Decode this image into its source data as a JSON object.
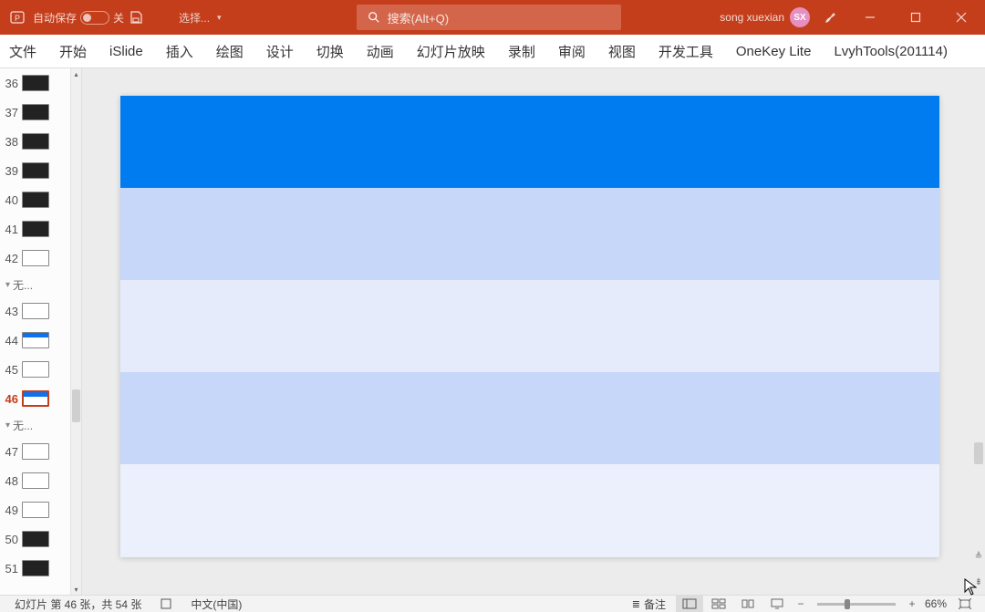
{
  "title_bar": {
    "autosave_label": "自动保存",
    "autosave_state": "关",
    "select_label": "选择...",
    "search_placeholder": "搜索(Alt+Q)",
    "user_name": "song xuexian",
    "user_initials": "SX"
  },
  "ribbon": {
    "tabs": [
      "文件",
      "开始",
      "iSlide",
      "插入",
      "绘图",
      "设计",
      "切换",
      "动画",
      "幻灯片放映",
      "录制",
      "审阅",
      "视图",
      "开发工具",
      "OneKey Lite",
      "LvyhTools(201114)"
    ],
    "active_index": -1
  },
  "slides_pane": {
    "items": [
      {
        "num": "36",
        "kind": "dark"
      },
      {
        "num": "37",
        "kind": "dark"
      },
      {
        "num": "38",
        "kind": "dark"
      },
      {
        "num": "39",
        "kind": "dark"
      },
      {
        "num": "40",
        "kind": "dark"
      },
      {
        "num": "41",
        "kind": "dark"
      },
      {
        "num": "42",
        "kind": "white"
      }
    ],
    "section1": "无...",
    "items2": [
      {
        "num": "43",
        "kind": "white"
      },
      {
        "num": "44",
        "kind": "whiteblue"
      },
      {
        "num": "45",
        "kind": "white"
      },
      {
        "num": "46",
        "kind": "whiteblue",
        "current": true
      }
    ],
    "section2": "无...",
    "items3": [
      {
        "num": "47",
        "kind": "white"
      },
      {
        "num": "48",
        "kind": "white"
      },
      {
        "num": "49",
        "kind": "white"
      },
      {
        "num": "50",
        "kind": "dark"
      },
      {
        "num": "51",
        "kind": "dark"
      }
    ]
  },
  "status": {
    "slide_counter": "幻灯片 第 46 张，共 54 张",
    "language": "中文(中国)",
    "notes_label": "备注",
    "zoom": "66%"
  }
}
